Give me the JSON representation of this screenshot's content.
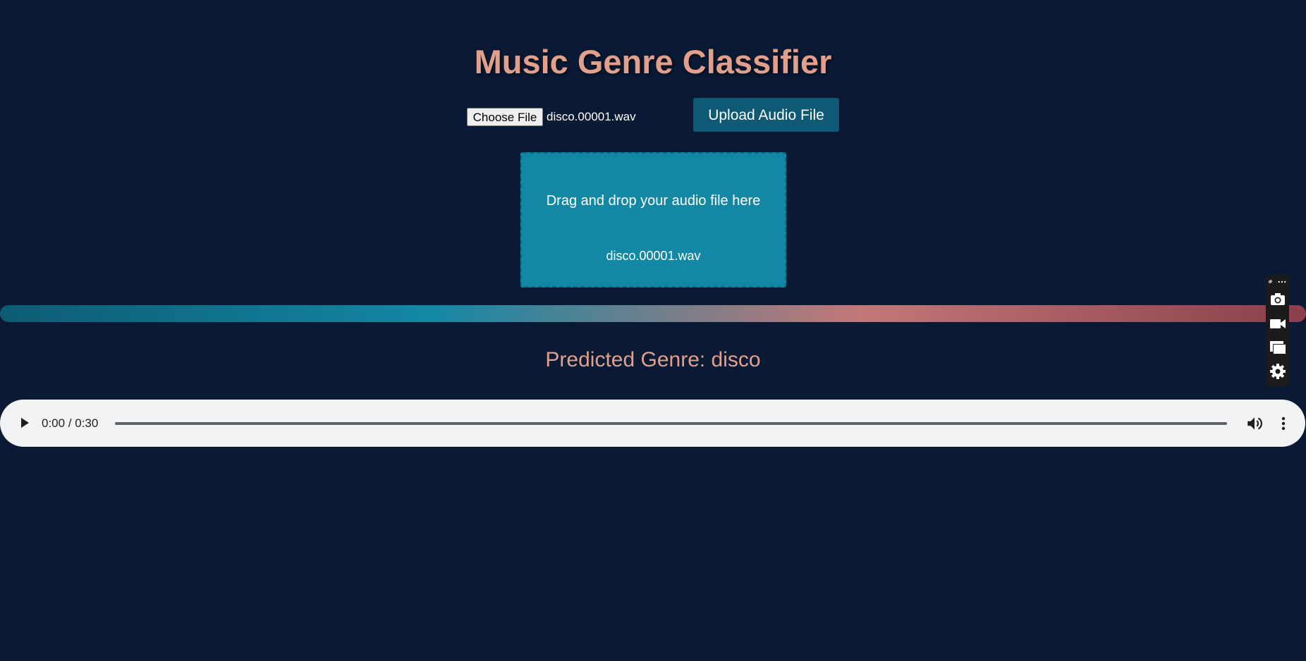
{
  "app": {
    "title": "Music Genre Classifier"
  },
  "upload": {
    "choose_file_label": "Choose File",
    "selected_file": "disco.00001.wav",
    "upload_button_label": "Upload Audio File"
  },
  "dropzone": {
    "instruction": "Drag and drop your audio file here",
    "file_name": "disco.00001.wav"
  },
  "result": {
    "prediction_text": "Predicted Genre: disco"
  },
  "audio": {
    "time_display": "0:00 / 0:30",
    "progress": 0,
    "icons": {
      "play": "play-icon",
      "volume": "volume-icon",
      "more": "more-vert-icon"
    }
  },
  "side_toolbar": {
    "icons": [
      "link-icon",
      "ellipsis-icon",
      "camera-icon",
      "video-camera-icon",
      "window-icon",
      "gear-icon"
    ]
  },
  "colors": {
    "background": "#0a1a35",
    "title": "#e2a08c",
    "upload_button": "#0e5a74",
    "dropzone": "#1388a5",
    "gradient_start": "#0d5b72",
    "gradient_mid": "#1388a5",
    "gradient_mid2": "#c47776",
    "gradient_end": "#8a3f4c"
  }
}
